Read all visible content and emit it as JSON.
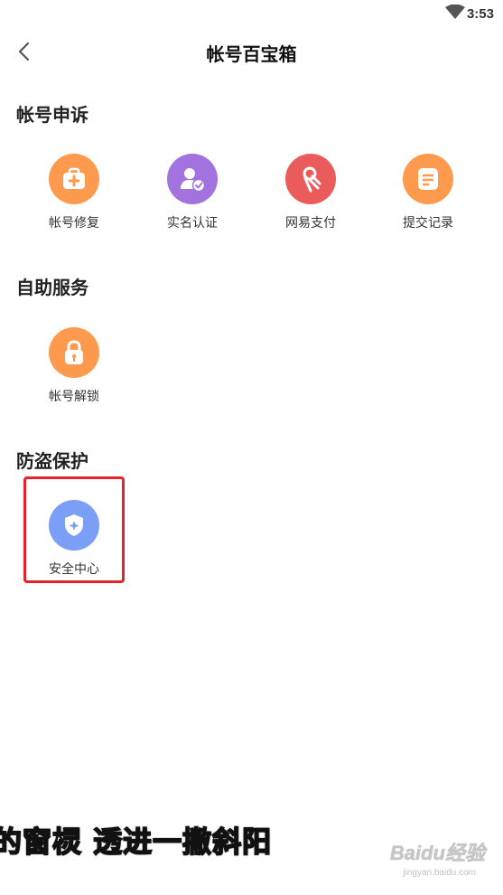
{
  "status_bar": {
    "time": "3:53"
  },
  "header": {
    "title": "帐号百宝箱"
  },
  "sections": [
    {
      "title": "帐号申诉",
      "items": [
        {
          "label": "帐号修复",
          "icon": "medical-kit-icon",
          "color": "#fd9a4e"
        },
        {
          "label": "实名认证",
          "icon": "verified-user-icon",
          "color": "#a272de"
        },
        {
          "label": "网易支付",
          "icon": "payment-icon",
          "color": "#ea5b5c"
        },
        {
          "label": "提交记录",
          "icon": "document-icon",
          "color": "#fd9a4e"
        }
      ]
    },
    {
      "title": "自助服务",
      "items": [
        {
          "label": "帐号解锁",
          "icon": "lock-icon",
          "color": "#fd9a4e"
        }
      ]
    },
    {
      "title": "防盗保护",
      "items": [
        {
          "label": "安全中心",
          "icon": "shield-icon",
          "color": "#7b9ff6"
        }
      ]
    }
  ],
  "overlay": {
    "subtitle": "的窗棂 透进一撇斜阳",
    "watermark": "Baidu经验",
    "watermark_url": "jingyan.baidu.com"
  }
}
